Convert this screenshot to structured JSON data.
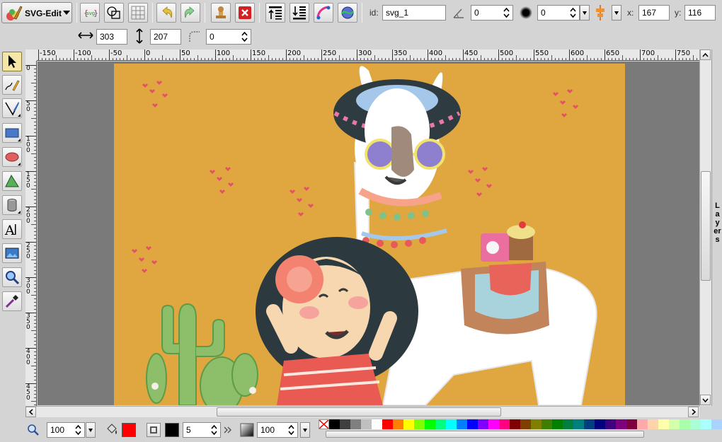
{
  "app": {
    "menu_label": "SVG-Edit",
    "icons": [
      "svg-edit-logo-icon",
      "source-icon",
      "wireframe-icon",
      "grid-icon",
      "undo-icon",
      "redo-icon",
      "clone-icon",
      "delete-icon",
      "move-top-icon",
      "move-bottom-icon",
      "reorient-path-icon",
      "convert-path-icon"
    ]
  },
  "element_panel": {
    "id_label": "id:",
    "id_value": "svg_1",
    "angle_value": "0",
    "blur_value": "0",
    "x_label": "x:",
    "x_value": "167",
    "y_label": "y:",
    "y_value": "116",
    "width_value": "303",
    "height_value": "207",
    "corner_radius_value": "0"
  },
  "ruler_top": [
    "-150",
    "-100",
    "-50",
    "0",
    "50",
    "100",
    "150",
    "200",
    "250",
    "300",
    "350",
    "400",
    "450",
    "500",
    "550",
    "600",
    "650",
    "700",
    "750"
  ],
  "ruler_left": [
    "0",
    "5\n0",
    "1\n0\n0",
    "1\n5\n0",
    "2\n0\n0",
    "2\n5\n0",
    "3\n0\n0",
    "3\n5\n0",
    "4\n0\n0",
    "4\n5\n0"
  ],
  "layers_label": "Layers",
  "bottom": {
    "zoom_value": "100",
    "stroke_width_value": "5",
    "opacity_value": "100",
    "fill_color": "#ff0000",
    "stroke_color": "#000000"
  },
  "colors": {
    "canvas_bg": "#e0a63f",
    "workarea_bg": "#7a7a7a"
  },
  "palette": [
    "#000000",
    "#3f3f3f",
    "#7f7f7f",
    "#bfbfbf",
    "#ffffff",
    "#ff0000",
    "#ff7f00",
    "#ffff00",
    "#7fff00",
    "#00ff00",
    "#00ff7f",
    "#00ffff",
    "#007fff",
    "#0000ff",
    "#7f00ff",
    "#ff00ff",
    "#ff007f",
    "#7f0000",
    "#7f3f00",
    "#7f7f00",
    "#3f7f00",
    "#007f00",
    "#007f3f",
    "#007f7f",
    "#003f7f",
    "#00007f",
    "#3f007f",
    "#7f007f",
    "#7f003f",
    "#ffaaaa",
    "#ffd4aa",
    "#ffffaa",
    "#d4ffaa",
    "#aaffaa",
    "#aaffd4",
    "#aaffff",
    "#aad4ff"
  ]
}
